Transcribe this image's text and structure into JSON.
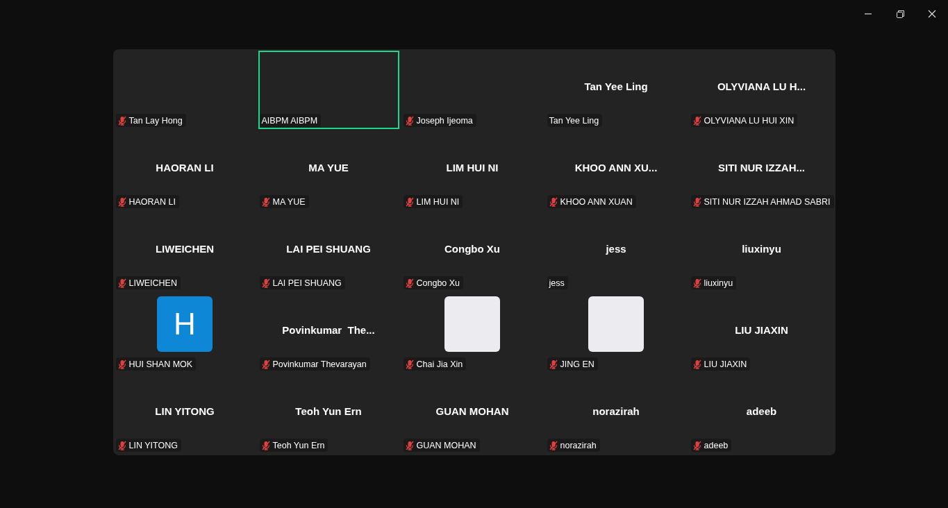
{
  "tiles": [
    {
      "kind": "blank",
      "label": "Tan Lay Hong",
      "muted": true,
      "active": false
    },
    {
      "kind": "blank",
      "label": "AIBPM AIBPM",
      "muted": false,
      "active": true
    },
    {
      "kind": "blank",
      "label": "Joseph Ijeoma",
      "muted": true,
      "active": false
    },
    {
      "kind": "name",
      "display": "Tan Yee Ling",
      "label": "Tan Yee Ling",
      "muted": false,
      "active": false
    },
    {
      "kind": "name",
      "display": "OLYVIANA LU H...",
      "label": "OLYVIANA LU HUI XIN",
      "muted": true,
      "active": false
    },
    {
      "kind": "name",
      "display": "HAORAN LI",
      "label": "HAORAN LI",
      "muted": true,
      "active": false
    },
    {
      "kind": "name",
      "display": "MA YUE",
      "label": "MA YUE",
      "muted": true,
      "active": false
    },
    {
      "kind": "name",
      "display": "LIM HUI NI",
      "label": "LIM HUI NI",
      "muted": true,
      "active": false
    },
    {
      "kind": "name",
      "display": "KHOO ANN XU...",
      "label": "KHOO ANN XUAN",
      "muted": true,
      "active": false
    },
    {
      "kind": "name",
      "display": "SITI NUR IZZAH...",
      "label": "SITI NUR IZZAH AHMAD SABRI",
      "muted": true,
      "active": false
    },
    {
      "kind": "name",
      "display": "LIWEICHEN",
      "label": "LIWEICHEN",
      "muted": true,
      "active": false
    },
    {
      "kind": "name",
      "display": "LAI PEI SHUANG",
      "label": "LAI PEI SHUANG",
      "muted": true,
      "active": false
    },
    {
      "kind": "name",
      "display": "Congbo Xu",
      "label": "Congbo Xu",
      "muted": true,
      "active": false
    },
    {
      "kind": "name",
      "display": "jess",
      "label": "jess",
      "muted": false,
      "active": false
    },
    {
      "kind": "name",
      "display": "liuxinyu",
      "label": "liuxinyu",
      "muted": true,
      "active": false
    },
    {
      "kind": "letter",
      "display": "H",
      "color": "#0e87d6",
      "label": "HUI SHAN MOK",
      "muted": true,
      "active": false
    },
    {
      "kind": "name",
      "display": "Povinkumar  The...",
      "label": "Povinkumar Thevarayan",
      "muted": true,
      "active": false
    },
    {
      "kind": "image",
      "label": "Chai Jia Xin",
      "muted": true,
      "active": false
    },
    {
      "kind": "image",
      "label": "JING EN",
      "muted": true,
      "active": false
    },
    {
      "kind": "name",
      "display": "LIU JIAXIN",
      "label": "LIU JIAXIN",
      "muted": true,
      "active": false
    },
    {
      "kind": "name",
      "display": "LIN YITONG",
      "label": "LIN YITONG",
      "muted": true,
      "active": false
    },
    {
      "kind": "name",
      "display": "Teoh Yun Ern",
      "label": "Teoh Yun Ern",
      "muted": true,
      "active": false
    },
    {
      "kind": "name",
      "display": "GUAN MOHAN",
      "label": "GUAN MOHAN",
      "muted": true,
      "active": false
    },
    {
      "kind": "name",
      "display": "norazirah",
      "label": "norazirah",
      "muted": true,
      "active": false
    },
    {
      "kind": "name",
      "display": "adeeb",
      "label": "adeeb",
      "muted": true,
      "active": false
    }
  ]
}
